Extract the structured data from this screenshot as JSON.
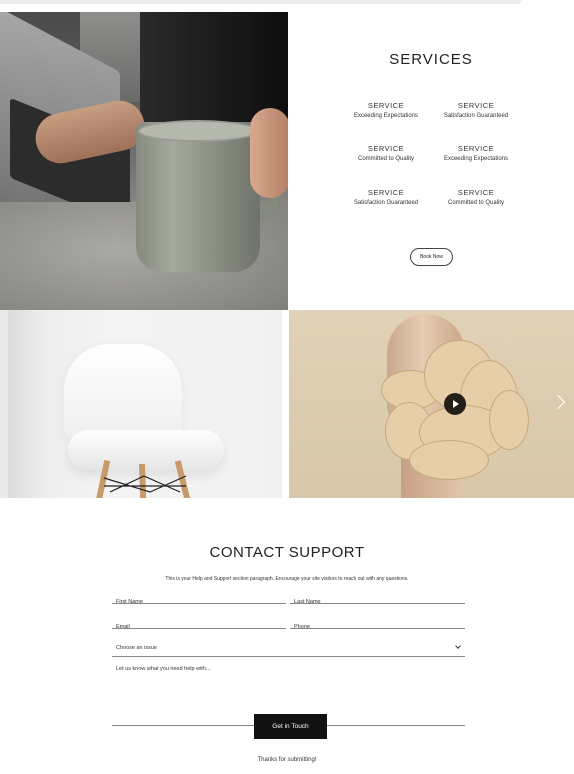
{
  "services": {
    "title": "SERVICES",
    "items": [
      {
        "name": "SERVICE",
        "description": "Exceeding Expectations"
      },
      {
        "name": "SERVICE",
        "description": "Satisfaction Guaranteed"
      },
      {
        "name": "SERVICE",
        "description": "Committed to Quality"
      },
      {
        "name": "SERVICE",
        "description": "Exceeding Expectations"
      },
      {
        "name": "SERVICE",
        "description": "Satisfaction Guaranteed"
      },
      {
        "name": "SERVICE",
        "description": "Committed to Quality"
      }
    ],
    "book_button": "Book Now"
  },
  "gallery": {
    "play_icon": "play-icon",
    "next_icon": "chevron-right-icon"
  },
  "contact": {
    "title": "CONTACT SUPPORT",
    "paragraph": "This is your Help and Support section paragraph. Encourage your site visitors to reach out with any questions.",
    "first_name_placeholder": "First Name",
    "last_name_placeholder": "Last Name",
    "email_placeholder": "Email",
    "phone_placeholder": "Phone",
    "issue_select_value": "Choose an issue",
    "message_placeholder": "Let us know what you need help with...",
    "submit_label": "Get in Touch",
    "thanks_text": "Thanks for submitting!"
  },
  "colors": {
    "button_bg": "#111111",
    "text": "#222222"
  }
}
